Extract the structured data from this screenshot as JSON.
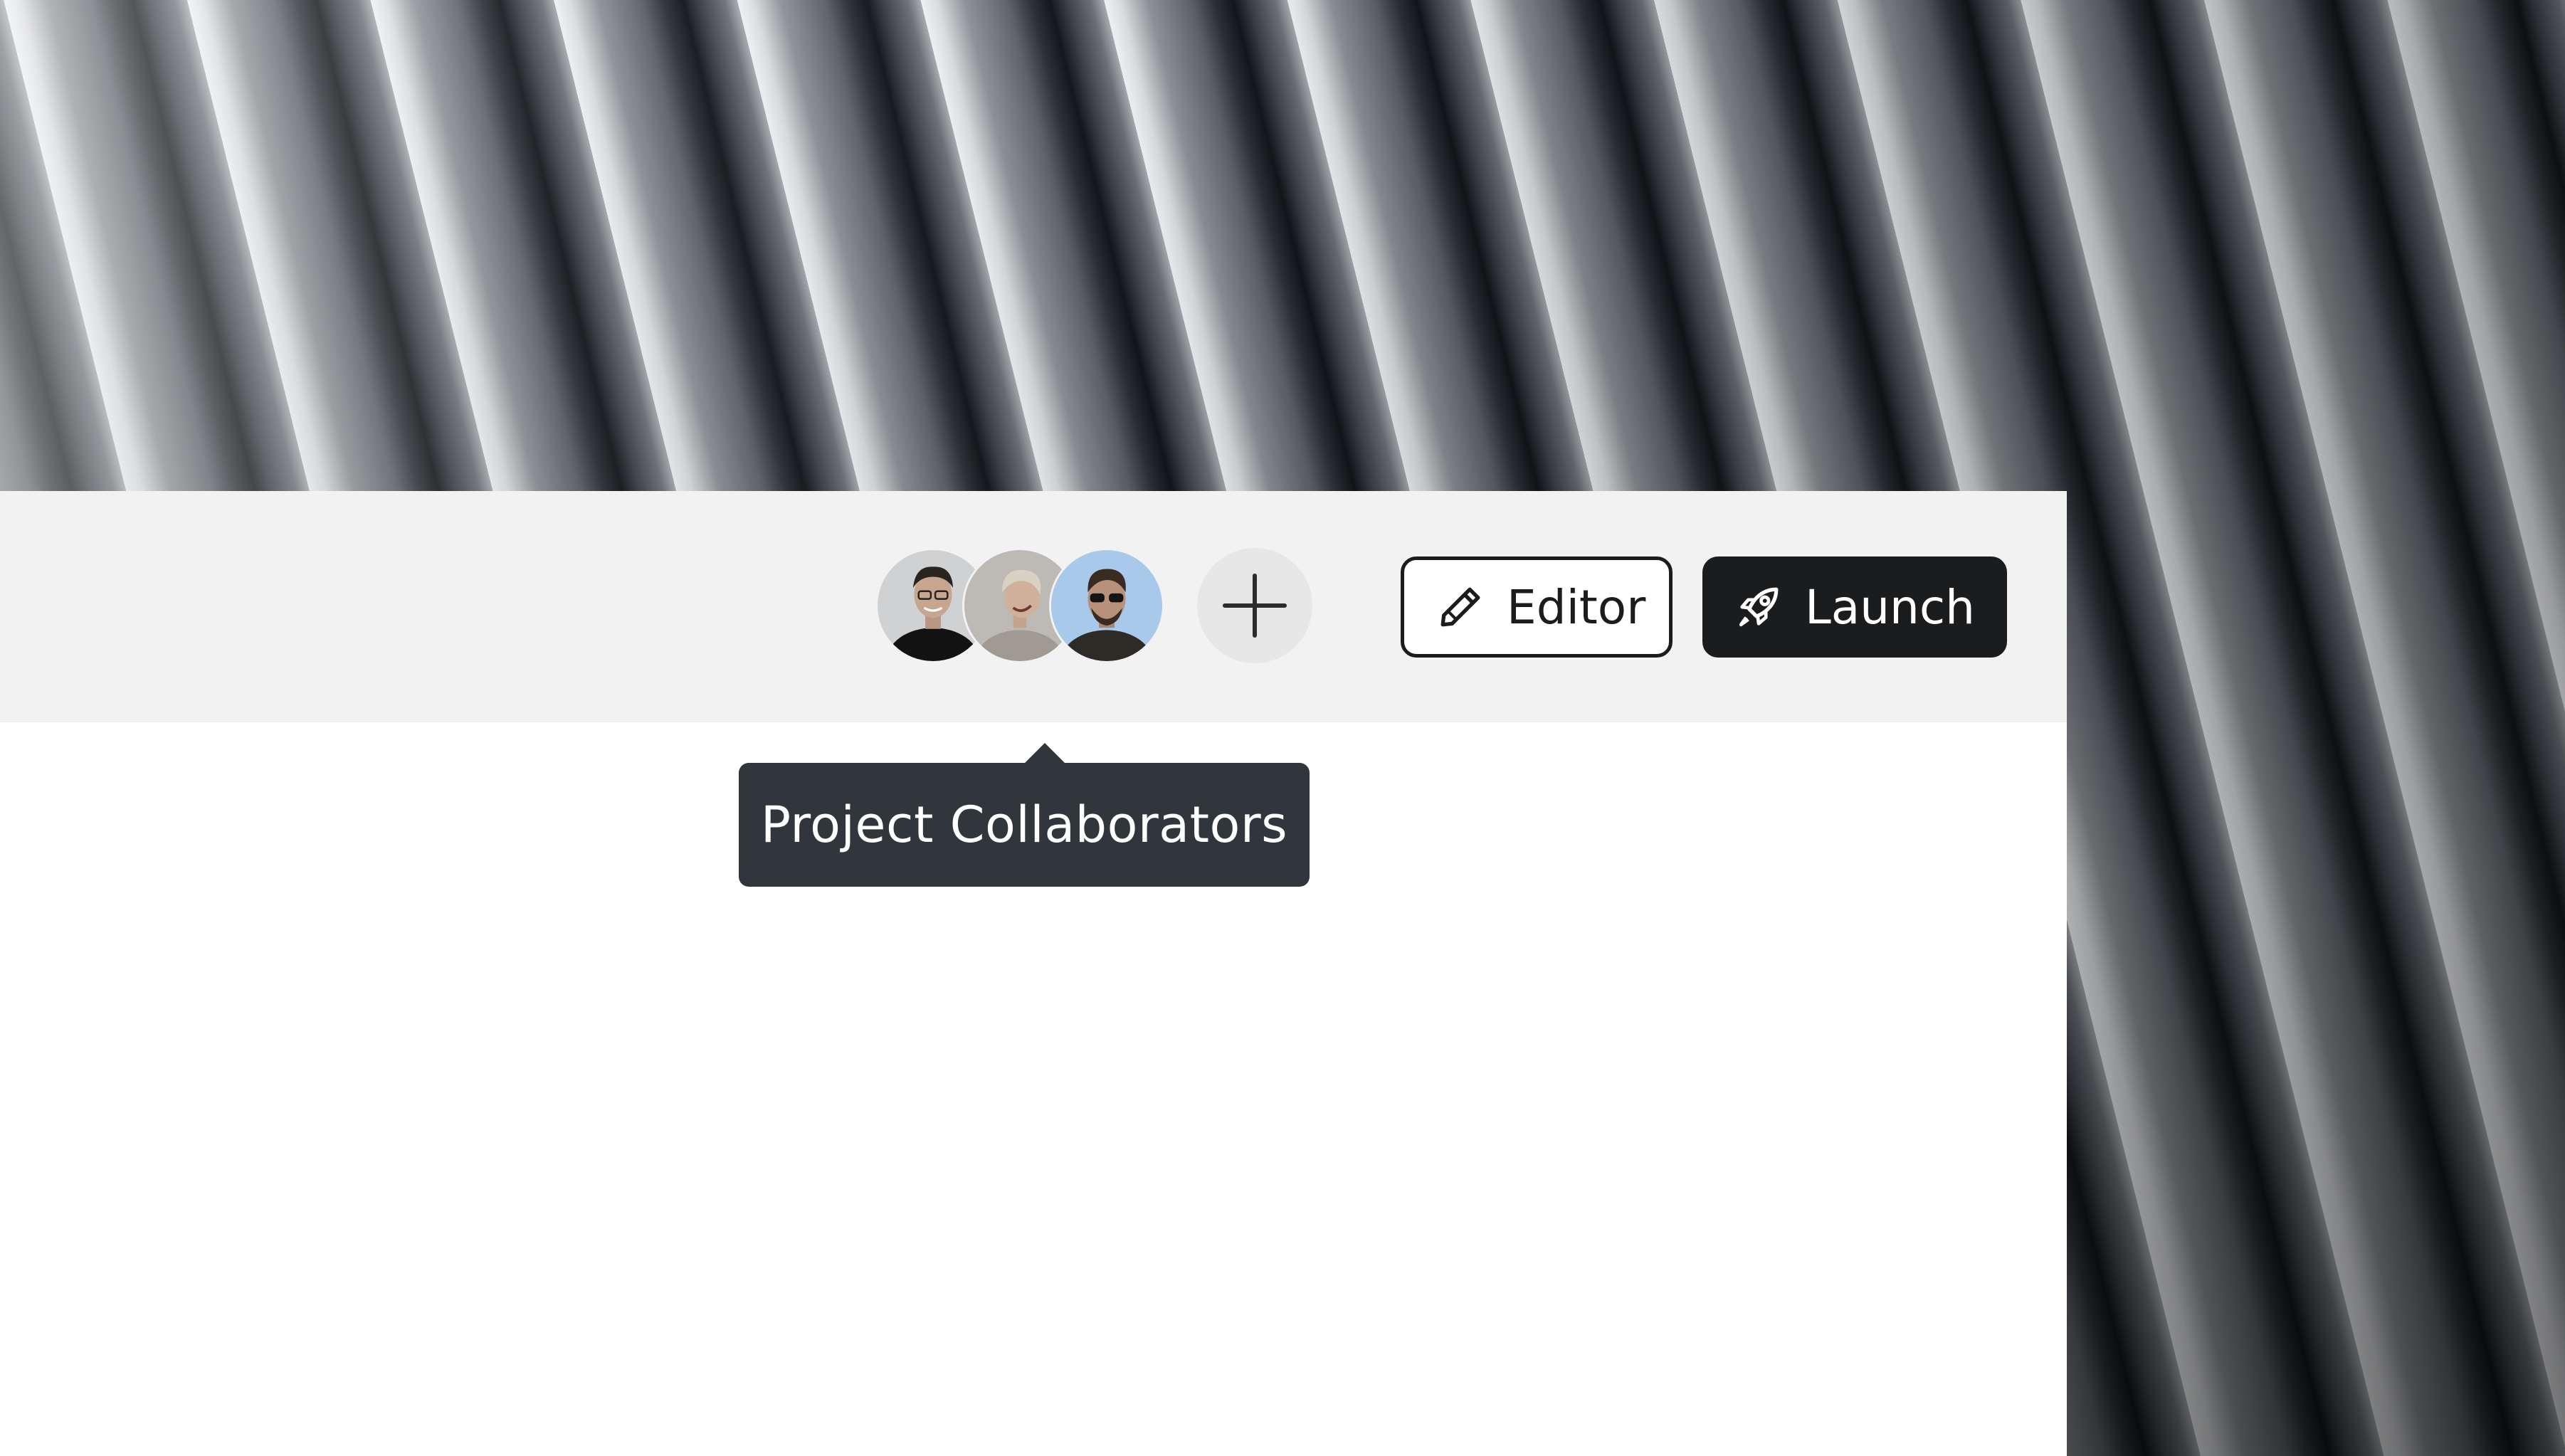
{
  "toolbar": {
    "collaborators": [
      {
        "name": "collaborator-1",
        "bg_color": "#c9cbcd"
      },
      {
        "name": "collaborator-2",
        "bg_color": "#b9b6b2"
      },
      {
        "name": "collaborator-3",
        "bg_color": "#a9c9ea"
      }
    ],
    "add_icon": "plus-icon",
    "editor_button": {
      "label": "Editor",
      "icon": "pencil-icon"
    },
    "launch_button": {
      "label": "Launch",
      "icon": "rocket-icon"
    }
  },
  "tooltip": {
    "text": "Project Collaborators"
  },
  "colors": {
    "toolbar_bg": "#f2f2f2",
    "primary_dark": "#1b1c1e",
    "tooltip_bg": "#30363c",
    "add_button_bg": "#e7e7e7"
  }
}
